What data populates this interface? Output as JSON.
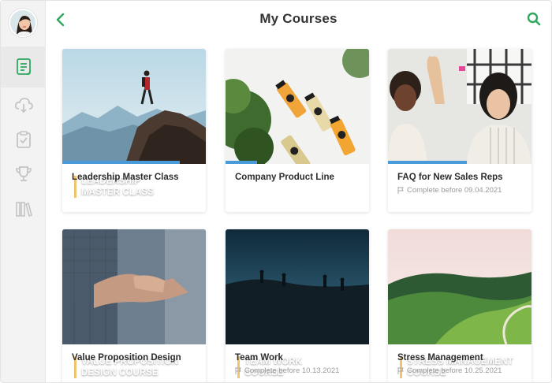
{
  "header": {
    "title": "My Courses"
  },
  "icons": {
    "back": "chevron-left-icon",
    "search": "search-icon",
    "nav": [
      "courses-icon",
      "cloud-download-icon",
      "clipboard-check-icon",
      "trophy-icon",
      "library-icon"
    ]
  },
  "colors": {
    "accent": "#2fa85e",
    "progress": "#4a9bd9",
    "overlay_bar": "#f2c36b"
  },
  "courses": [
    {
      "title": "Leadership Master Class",
      "overlay": "LEADERSHIP\nMASTER CLASS",
      "meta": "",
      "progress": 0.82
    },
    {
      "title": "Company Product Line",
      "overlay": "",
      "meta": "",
      "progress": 0.22
    },
    {
      "title": "FAQ for New Sales Reps",
      "overlay": "",
      "meta": "Complete before 09.04.2021",
      "progress": 0.55
    },
    {
      "title": "Value Proposition Design",
      "overlay": "VALUE PROPOSITION\nDESIGN COURSE",
      "meta": "",
      "progress": 0
    },
    {
      "title": "Team Work",
      "overlay": "TEAM WORK\nCOURSE",
      "meta": "Complete before 10.13.2021",
      "progress": 0
    },
    {
      "title": "Stress Management",
      "overlay": "STRESS MANAGEMENT\nCOURSE",
      "meta": "Complete before 10.25.2021",
      "progress": 0
    }
  ]
}
